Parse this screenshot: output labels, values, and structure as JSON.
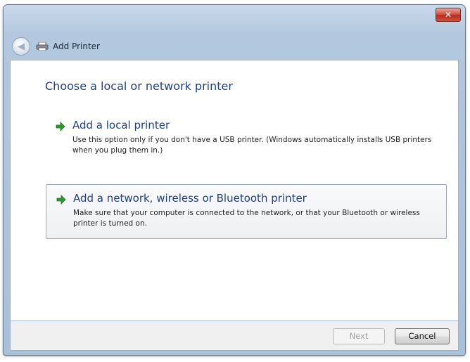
{
  "window": {
    "title": "Add Printer",
    "close_label": "✕",
    "back_label": "◀"
  },
  "content": {
    "heading": "Choose a local or network printer",
    "options": [
      {
        "title": "Add a local printer",
        "description": "Use this option only if you don't have a USB printer. (Windows automatically installs USB printers when you plug them in.)"
      },
      {
        "title": "Add a network, wireless or Bluetooth printer",
        "description": "Make sure that your computer is connected to the network, or that your Bluetooth or wireless printer is turned on."
      }
    ]
  },
  "footer": {
    "next_label": "Next",
    "cancel_label": "Cancel"
  },
  "icons": {
    "close": "close-icon",
    "back": "back-arrow-icon",
    "printer": "printer-icon",
    "option_arrow": "green-arrow-icon"
  },
  "colors": {
    "accent_text": "#1e3f8c",
    "arrow_green": "#2e9b2e",
    "close_red": "#c9503c"
  }
}
